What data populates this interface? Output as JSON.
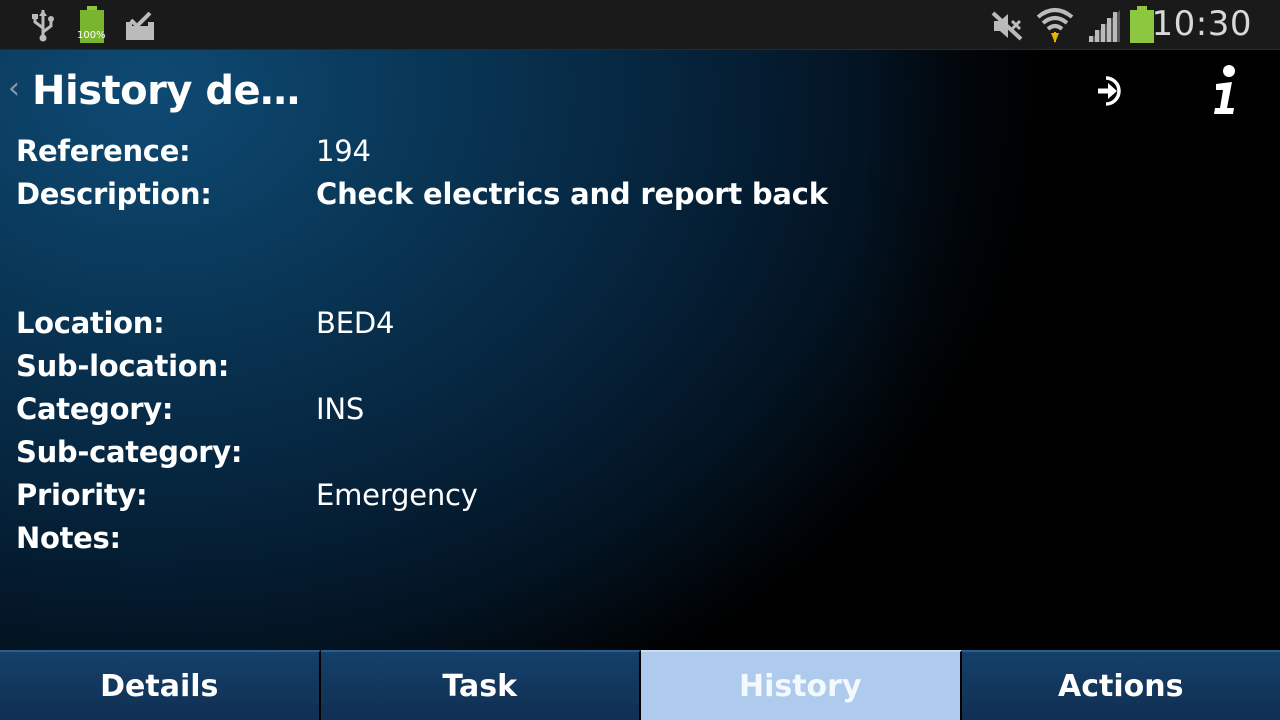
{
  "status_bar": {
    "time": "10:30",
    "battery_left_label": "100%",
    "icons": [
      "usb-icon",
      "battery-full-icon",
      "clipboard-check-icon",
      "mute-icon",
      "wifi-icon",
      "signal-icon",
      "battery-icon"
    ],
    "accent": "#8dc63f"
  },
  "header": {
    "back_glyph": "‹",
    "title": "History de…",
    "icons": [
      "logout-icon",
      "info-icon"
    ]
  },
  "details": [
    {
      "label": "Reference:",
      "value": "194"
    },
    {
      "label": "Description:",
      "value": "Check electrics and report back"
    },
    {
      "label": "Location:",
      "value": "BED4"
    },
    {
      "label": "Sub-location:",
      "value": ""
    },
    {
      "label": "Category:",
      "value": "INS"
    },
    {
      "label": "Sub-category:",
      "value": ""
    },
    {
      "label": "Priority:",
      "value": "Emergency"
    },
    {
      "label": "Notes:",
      "value": ""
    }
  ],
  "tabs": [
    {
      "label": "Details",
      "active": false
    },
    {
      "label": "Task",
      "active": false
    },
    {
      "label": "History",
      "active": true
    },
    {
      "label": "Actions",
      "active": false
    }
  ],
  "colors": {
    "tab_active": "#aecbee",
    "tab_inactive": "#15406a",
    "background_accent": "#0a3a5c"
  }
}
